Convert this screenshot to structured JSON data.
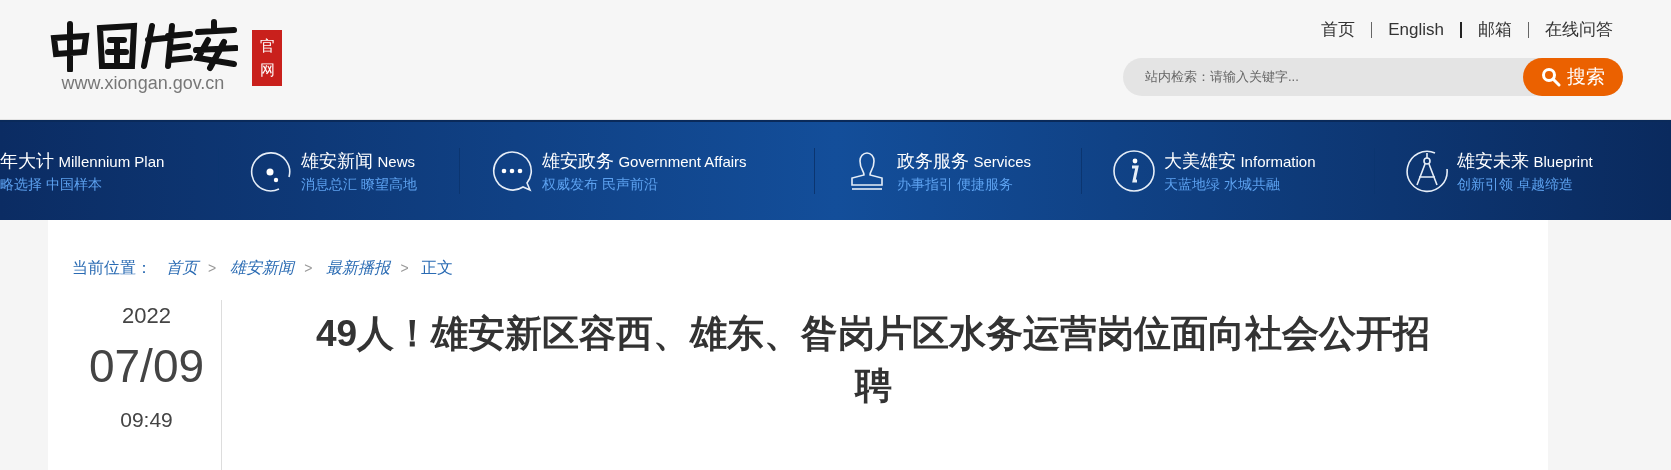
{
  "header": {
    "logo_url": "www.xiongan.gov.cn",
    "seal": "官网",
    "top_links": [
      "首页",
      "English",
      "邮箱",
      "在线问答"
    ],
    "search": {
      "placeholder": "站内检索：请输入关键字...",
      "button": "搜索"
    }
  },
  "nav": [
    {
      "title": "年大计",
      "en": "Millennium Plan",
      "sub": "略选择 中国样本"
    },
    {
      "title": "雄安新闻",
      "en": "News",
      "sub": "消息总汇 瞭望高地"
    },
    {
      "title": "雄安政务",
      "en": "Government Affairs",
      "sub": "权威发布 民声前沿"
    },
    {
      "title": "政务服务",
      "en": "Services",
      "sub": "办事指引 便捷服务"
    },
    {
      "title": "大美雄安",
      "en": "Information",
      "sub": "天蓝地绿 水城共融"
    },
    {
      "title": "雄安未来",
      "en": "Blueprint",
      "sub": "创新引领 卓越缔造"
    }
  ],
  "breadcrumb": {
    "label": "当前位置：",
    "items": [
      "首页",
      "雄安新闻",
      "最新播报"
    ],
    "separator": ">",
    "current": "正文"
  },
  "article": {
    "year": "2022",
    "date": "07/09",
    "time": "09:49",
    "title": "49人！雄安新区容西、雄东、昝岗片区水务运营岗位面向社会公开招聘"
  }
}
